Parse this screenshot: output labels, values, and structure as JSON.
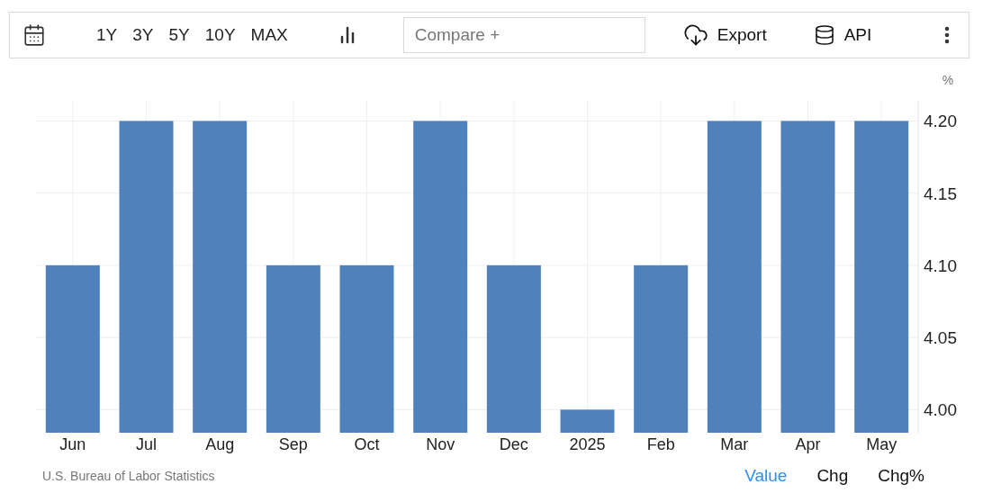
{
  "toolbar": {
    "ranges": [
      "1Y",
      "3Y",
      "5Y",
      "10Y",
      "MAX"
    ],
    "compare": {
      "placeholder": "Compare +"
    },
    "export": "Export",
    "api": "API"
  },
  "chart": {
    "unit": "%",
    "chart_data": {
      "type": "bar",
      "categories": [
        "Jun",
        "Jul",
        "Aug",
        "Sep",
        "Oct",
        "Nov",
        "Dec",
        "2025",
        "Feb",
        "Mar",
        "Apr",
        "May"
      ],
      "grid": true,
      "series": [
        {
          "color": "#4f81bd",
          "values": [
            4.1,
            4.2,
            4.2,
            4.1,
            4.1,
            4.2,
            4.1,
            4.0,
            4.1,
            4.2,
            4.2,
            4.2
          ]
        }
      ],
      "ylim": [
        3.984,
        4.214
      ],
      "yticks": [
        {
          "value": 4.0,
          "label": "4.00"
        },
        {
          "value": 4.05,
          "label": "4.05"
        },
        {
          "value": 4.1,
          "label": "4.10"
        },
        {
          "value": 4.15,
          "label": "4.15"
        },
        {
          "value": 4.2,
          "label": "4.20"
        }
      ]
    }
  },
  "footer": {
    "source": "U.S. Bureau of Labor Statistics",
    "views": [
      {
        "label": "Value",
        "selected": true
      },
      {
        "label": "Chg",
        "selected": false
      },
      {
        "label": "Chg%",
        "selected": false
      }
    ]
  }
}
